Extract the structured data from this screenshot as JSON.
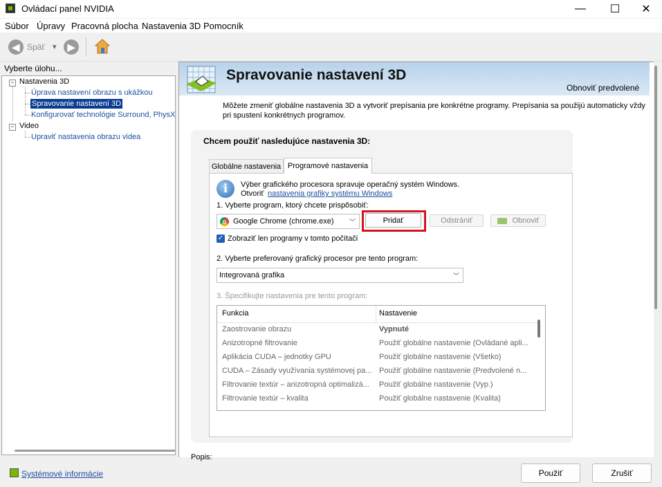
{
  "window": {
    "title": "Ovládací panel NVIDIA",
    "minimize": "—",
    "maximize": "☐",
    "close": "✕"
  },
  "menu": [
    "Súbor",
    "Úpravy",
    "Pracovná plocha",
    "Nastavenia 3D",
    "Pomocník"
  ],
  "toolbar": {
    "back_label": "Späť",
    "back_arrow": "◀",
    "forward_arrow": "▶",
    "dropdown_arrow": "▾"
  },
  "sidebar": {
    "label": "Vyberte úlohu...",
    "tree": [
      {
        "label": "Nastavenia 3D",
        "expander": "−"
      },
      {
        "label": "Úprava nastavení obrazu s ukážkou"
      },
      {
        "label": "Spravovanie nastavení 3D",
        "selected": true
      },
      {
        "label": "Konfigurovať technológie Surround, PhysX"
      },
      {
        "label": "Video",
        "expander": "−"
      },
      {
        "label": "Upraviť nastavenia obrazu videa"
      }
    ],
    "system_info": "Systémové informácie"
  },
  "page": {
    "title": "Spravovanie nastavení 3D",
    "restore_defaults": "Obnoviť predvolené",
    "description": "Môžete zmeniť globálne nastavenia 3D a vytvoriť prepísania pre konkrétne programy. Prepísania sa použijú automaticky vždy pri spustení konkrétnych programov.",
    "group_title": "Chcem použiť nasledujúce nastavenia 3D:",
    "tabs": [
      "Globálne nastavenia",
      "Programové nastavenia"
    ],
    "info_line1": "Výber grafického procesora spravuje operačný systém Windows.",
    "info_line2_prefix": "Otvoriť",
    "info_link": "nastavenia grafiky systému Windows",
    "step1_label": "1. Vyberte program, ktorý chcete prispôsobiť:",
    "program_selected": "Google Chrome (chrome.exe)",
    "add_button": "Pridať",
    "remove_button": "Odstrániť",
    "restore_button": "Obnoviť",
    "checkbox_label": "Zobraziť len programy v tomto počítači",
    "checkbox_checked": true,
    "step2_label": "2. Vyberte preferovaný grafický procesor pre tento program:",
    "gpu_selected": "Integrovaná grafika",
    "step3_label": "3. Špecifikujte nastavenia pre tento program:",
    "table": {
      "headers": [
        "Funkcia",
        "Nastavenie"
      ],
      "rows": [
        [
          "Zaostrovanie obrazu",
          "Vypnuté"
        ],
        [
          "Anizotropné filtrovanie",
          "Použiť globálne nastavenie (Ovládané apli..."
        ],
        [
          "Aplikácia CUDA – jednotky GPU",
          "Použiť globálne nastavenie (Všetko)"
        ],
        [
          "CUDA – Zásady využívania systémovej pa...",
          "Použiť globálne nastavenie (Predvolené n..."
        ],
        [
          "Filtrovanie textúr – anizotropná optimalizá...",
          "Použiť globálne nastavenie (Vyp.)"
        ],
        [
          "Filtrovanie textúr – kvalita",
          "Použiť globálne nastavenie (Kvalita)"
        ]
      ]
    },
    "description_label": "Popis:",
    "apply_button": "Použiť",
    "cancel_button": "Zrušiť"
  },
  "colors": {
    "nvidia_green": "#76b900",
    "highlight_red": "#d6121e",
    "link_blue": "#1a4fa0",
    "selection_blue": "#0a3d91"
  }
}
